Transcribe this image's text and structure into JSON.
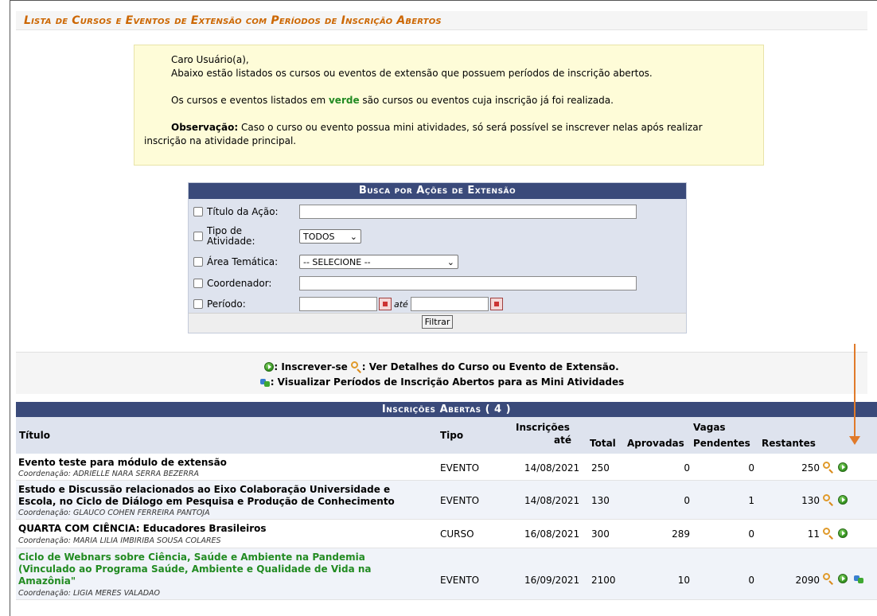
{
  "page": {
    "title": "Lista de Cursos e Eventos de Extensão com Períodos de Inscrição Abertos"
  },
  "notice": {
    "greeting": "Caro Usuário(a),",
    "line1": "Abaixo estão listados os cursos ou eventos de extensão que possuem períodos de inscrição abertos.",
    "line2_pre": "Os cursos e eventos listados em ",
    "line2_green": "verde",
    "line2_post": " são cursos ou eventos cuja inscrição já foi realizada.",
    "obs_label": "Observação:",
    "obs_text": " Caso o curso ou evento possua mini atividades, só será possível se inscrever nelas após realizar",
    "obs_text2": "inscrição na atividade principal."
  },
  "search": {
    "caption": "Busca por Ações de Extensão",
    "titulo_label": "Título da Ação:",
    "tipo_label": "Tipo de Atividade:",
    "tipo_value": "TODOS",
    "area_label": "Área Temática:",
    "area_value": "-- SELECIONE --",
    "coord_label": "Coordenador:",
    "periodo_label": "Período:",
    "ate": "até",
    "filter_button": "Filtrar"
  },
  "legend": {
    "inscrever": ": Inscrever-se",
    "detalhes": ": Ver Detalhes do Curso ou Evento de Extensão.",
    "mini": ": Visualizar Períodos de Inscrição Abertos para as Mini Atividades"
  },
  "table": {
    "caption": "Inscrições Abertas ( 4 )",
    "headers": {
      "titulo": "Título",
      "tipo": "Tipo",
      "inscricoes": "Inscrições",
      "ate": "até",
      "vagas": "Vagas",
      "total": "Total",
      "aprovadas": "Aprovadas",
      "pendentes": "Pendentes",
      "restantes": "Restantes"
    },
    "rows": [
      {
        "title1": "Evento teste para módulo de extensão",
        "title2": "",
        "title3": "",
        "coord": "Coordenação: ADRIELLE NARA SERRA BEZERRA",
        "tipo": "EVENTO",
        "data": "14/08/2021",
        "total": "250",
        "aprovadas": "0",
        "pendentes": "0",
        "restantes": "250"
      },
      {
        "title1": "Estudo e Discussão relacionados ao Eixo Colaboração Universidade e",
        "title2": "Escola, no Ciclo de Diálogo em Pesquisa e Produção de Conhecimento",
        "title3": "",
        "coord": "Coordenação: GLAUCO COHEN FERREIRA PANTOJA",
        "tipo": "EVENTO",
        "data": "14/08/2021",
        "total": "130",
        "aprovadas": "0",
        "pendentes": "1",
        "restantes": "130"
      },
      {
        "title1": "QUARTA COM CIÊNCIA: Educadores Brasileiros",
        "title2": "",
        "title3": "",
        "coord": "Coordenação: MARIA LILIA IMBIRIBA SOUSA COLARES",
        "tipo": "CURSO",
        "data": "16/08/2021",
        "total": "300",
        "aprovadas": "289",
        "pendentes": "0",
        "restantes": "11"
      },
      {
        "title1": "Ciclo de Webnars sobre Ciência, Saúde e Ambiente na Pandemia",
        "title2": "(Vinculado ao Programa Saúde, Ambiente e Qualidade de Vida na",
        "title3": "Amazônia\"",
        "coord": "Coordenação: LIGIA MERES VALADAO",
        "tipo": "EVENTO",
        "data": "16/09/2021",
        "total": "2100",
        "aprovadas": "10",
        "pendentes": "0",
        "restantes": "2090"
      }
    ]
  },
  "colors": {
    "title_orange": "#cc6600",
    "header_navy": "#3a4a7a",
    "registered_green": "#228B22",
    "annotation_arrow": "#e07a2a"
  }
}
